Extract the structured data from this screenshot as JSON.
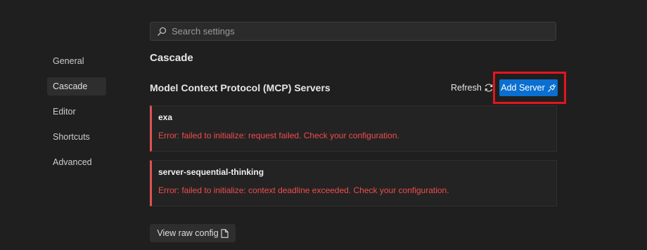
{
  "search": {
    "placeholder": "Search settings",
    "icon": "search-icon"
  },
  "sidebar": {
    "items": [
      {
        "label": "General",
        "active": false
      },
      {
        "label": "Cascade",
        "active": true
      },
      {
        "label": "Editor",
        "active": false
      },
      {
        "label": "Shortcuts",
        "active": false
      },
      {
        "label": "Advanced",
        "active": false
      }
    ]
  },
  "main": {
    "section_title": "Cascade",
    "mcp": {
      "title": "Model Context Protocol (MCP) Servers",
      "refresh_label": "Refresh",
      "add_server_label": "Add Server",
      "servers": [
        {
          "name": "exa",
          "error": "Error: failed to initialize: request failed. Check your configuration."
        },
        {
          "name": "server-sequential-thinking",
          "error": "Error: failed to initialize: context deadline exceeded. Check your configuration."
        }
      ]
    },
    "view_raw_label": "View raw config"
  },
  "colors": {
    "background": "#1f1f1f",
    "accent": "#0a6fd0",
    "error": "#f14c4c",
    "highlight": "#e3151d"
  }
}
